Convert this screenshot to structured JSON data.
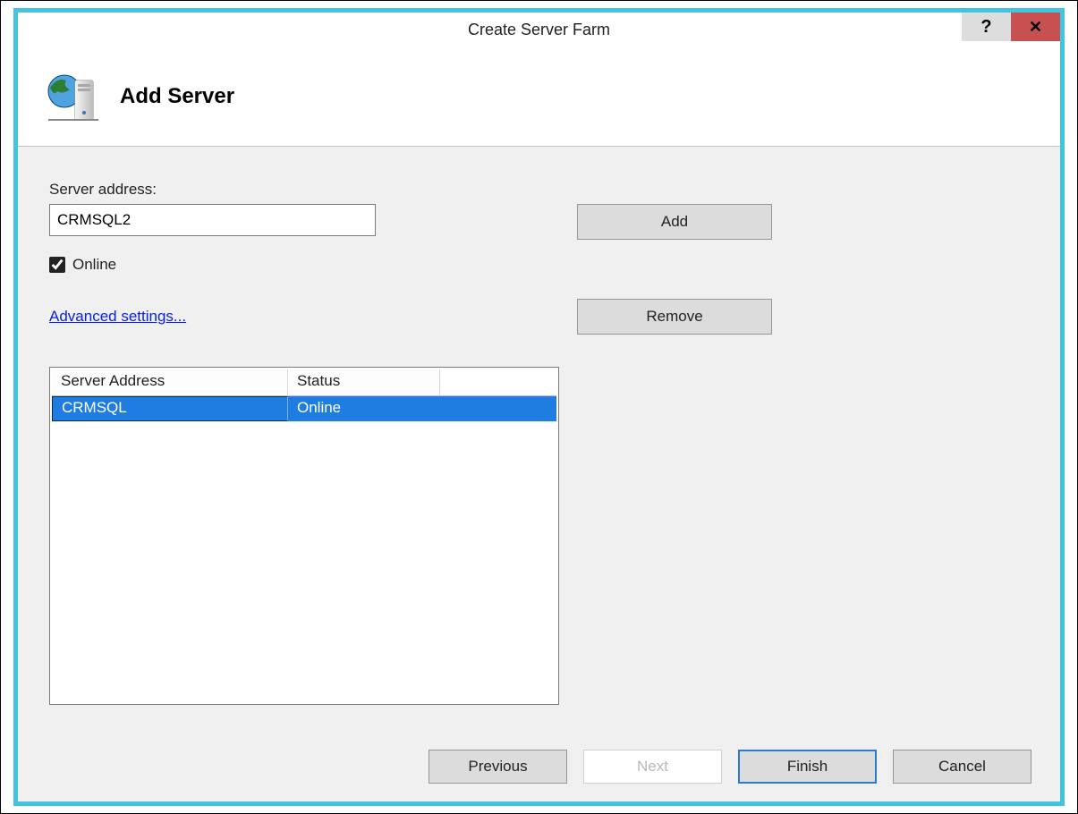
{
  "window": {
    "title": "Create Server Farm"
  },
  "header": {
    "heading": "Add Server"
  },
  "form": {
    "server_address_label": "Server address:",
    "server_address_value": "CRMSQL2",
    "online_label": "Online",
    "online_checked": true,
    "advanced_link": "Advanced settings..."
  },
  "buttons": {
    "add": "Add",
    "remove": "Remove"
  },
  "table": {
    "columns": {
      "address": "Server Address",
      "status": "Status"
    },
    "rows": [
      {
        "address": "CRMSQL",
        "status": "Online",
        "selected": true
      }
    ]
  },
  "wizard": {
    "previous": "Previous",
    "next": "Next",
    "finish": "Finish",
    "cancel": "Cancel"
  }
}
